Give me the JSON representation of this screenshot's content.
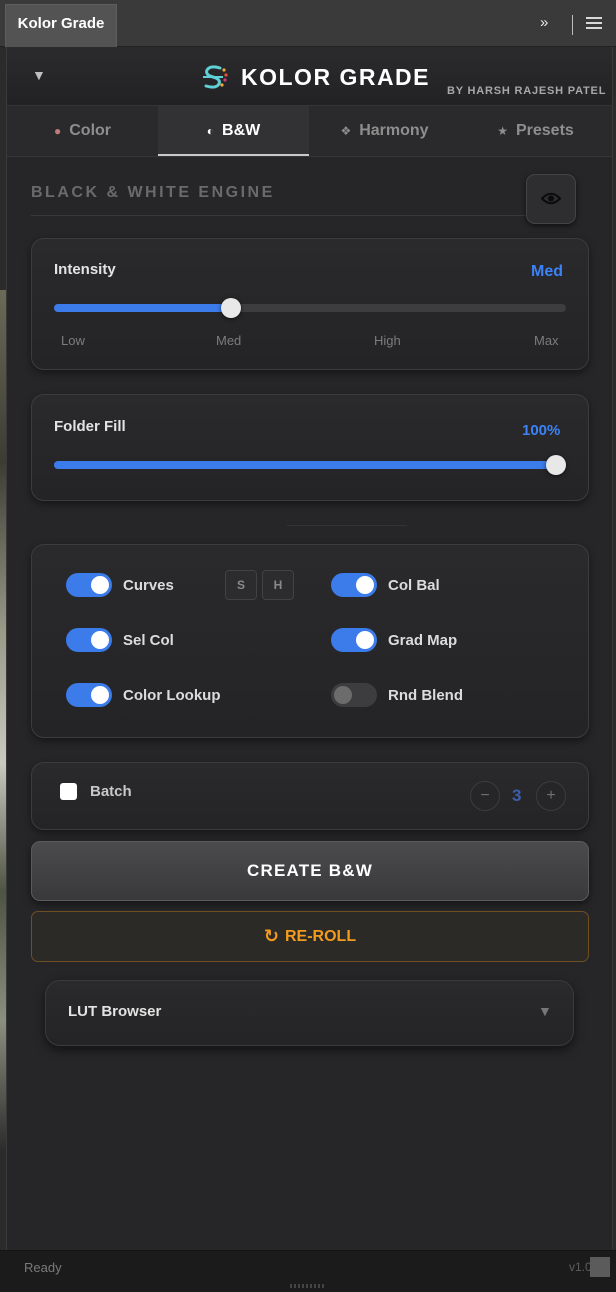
{
  "window": {
    "tab_title": "Kolor Grade",
    "collapse_glyph": "»",
    "menu_icon": "hamburger-menu-icon"
  },
  "header": {
    "toggle_glyph": "▼",
    "logo_icon": "kolor-grade-logo-icon",
    "title": "KOLOR GRADE",
    "byline": "BY HARSH RAJESH PATEL"
  },
  "tabs": [
    {
      "label": "Color",
      "icon": "●"
    },
    {
      "label": "B&W",
      "icon": "◐"
    },
    {
      "label": "Harmony",
      "icon": "❖"
    },
    {
      "label": "Presets",
      "icon": "★"
    }
  ],
  "active_tab": "B&W",
  "section": {
    "title": "BLACK & WHITE ENGINE",
    "preview_icon": "eye-icon"
  },
  "intensity": {
    "label": "Intensity",
    "value": "Med",
    "level": 0.34,
    "ticks": [
      "Low",
      "Med",
      "High",
      "Max"
    ]
  },
  "folder_fill": {
    "label": "Folder Fill",
    "value": "100%",
    "level": 1.0
  },
  "toggles": {
    "curves": {
      "label": "Curves",
      "on": true
    },
    "curves_s": "S",
    "curves_h": "H",
    "col_bal": {
      "label": "Col Bal",
      "on": true
    },
    "sel_col": {
      "label": "Sel Col",
      "on": true
    },
    "grad_map": {
      "label": "Grad Map",
      "on": true
    },
    "color_lookup": {
      "label": "Color Lookup",
      "on": true
    },
    "rnd_blend": {
      "label": "Rnd Blend",
      "on": false
    }
  },
  "batch": {
    "label": "Batch",
    "checked": false,
    "minus": "−",
    "count": "3",
    "plus": "+"
  },
  "actions": {
    "create": "CREATE B&W",
    "reroll": "RE-ROLL",
    "reroll_icon": "↻"
  },
  "lut_browser": {
    "label": "LUT Browser",
    "arrow": "▼"
  },
  "status": {
    "text": "Ready",
    "version": "v1.0"
  },
  "colors": {
    "accent_blue": "#3b7bea",
    "reroll_orange": "#f29b1d",
    "panel_bg": "#262628"
  }
}
